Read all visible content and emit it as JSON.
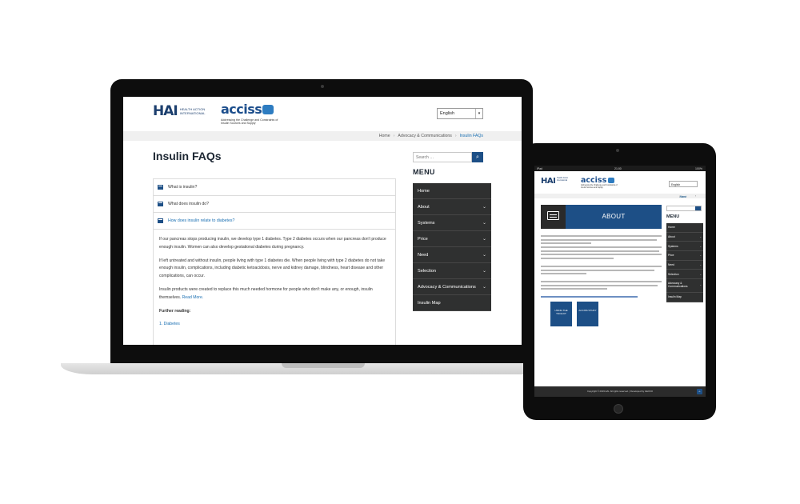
{
  "laptop": {
    "logos": {
      "hai_mark": "HAI",
      "hai_text": "Health Action International",
      "accs_word": "acciss",
      "accs_sub": "Addressing the Challenge and Constraints of Insulin Sources and Supply"
    },
    "language": "English",
    "breadcrumb": [
      "Home",
      "Advocacy & Communications",
      "Insulin FAQs"
    ],
    "page_title": "Insulin FAQs",
    "faq": [
      {
        "question": "What is insulin?",
        "expanded": false
      },
      {
        "question": "What does insulin do?",
        "expanded": false
      },
      {
        "question": "How does insulin relate to diabetes?",
        "expanded": true
      }
    ],
    "answer": {
      "p1": "If our pancreas stops producing insulin, we develop type 1 diabetes. Type 2 diabetes occurs when our pancreas don't produce enough insulin. Women can also develop gestational diabetes during pregnancy.",
      "p2": "If left untreated and without insulin, people living with type 1 diabetes die. When people living with type 2 diabetes do not take enough insulin, complications, including diabetic ketoacidosis, nerve and kidney damage, blindness, heart disease and other complications, can occur.",
      "p3": "Insulin products were created to replace this much needed hormone for people who don't make any, or enough, insulin themselves.",
      "read_more": "Read More.",
      "further_heading": "Further reading:",
      "further_link": "1. Diabetes"
    },
    "search_placeholder": "Search …",
    "menu_title": "MENU",
    "menu": [
      {
        "label": "Home",
        "chevron": false
      },
      {
        "label": "About",
        "chevron": true
      },
      {
        "label": "Systems",
        "chevron": true
      },
      {
        "label": "Price",
        "chevron": true
      },
      {
        "label": "Need",
        "chevron": true
      },
      {
        "label": "Selection",
        "chevron": true
      },
      {
        "label": "Advocacy & Communications",
        "chevron": true
      },
      {
        "label": "Insulin Map",
        "chevron": false
      }
    ]
  },
  "tablet": {
    "status": {
      "left": "iPad",
      "center": "21:00",
      "right": "100%"
    },
    "logos": {
      "hai_mark": "HAI",
      "hai_text": "Health Action International",
      "accs_word": "acciss",
      "accs_sub": "Addressing the Challenge and Constraints of Insulin Sources and Supply"
    },
    "language": "English",
    "breadcrumb": [
      "Home",
      "About"
    ],
    "banner_label": "ABOUT",
    "tiles": [
      "USING THE TOOLKIT",
      "ACCISS STUDY"
    ],
    "menu_title": "MENU",
    "menu": [
      {
        "label": "Home",
        "chevron": false
      },
      {
        "label": "About",
        "chevron": true
      },
      {
        "label": "Systems",
        "chevron": true
      },
      {
        "label": "Price",
        "chevron": true
      },
      {
        "label": "Need",
        "chevron": true
      },
      {
        "label": "Selection",
        "chevron": true
      },
      {
        "label": "Advocacy & Communications",
        "chevron": true
      },
      {
        "label": "Insulin Map",
        "chevron": false
      }
    ],
    "footer": "Copyright © 2019 HAI. All rights reserved. | Developed by GECKO"
  },
  "colors": {
    "brand_navy": "#1d4f86",
    "menu_bg": "#2f3030",
    "link_blue": "#1a6fb2",
    "device_frame": "#0d0d0d"
  },
  "icons": [
    "faq-toggle-icon",
    "search-icon",
    "chevron-down-icon",
    "chat-bubble-icon",
    "back-to-top-icon"
  ]
}
